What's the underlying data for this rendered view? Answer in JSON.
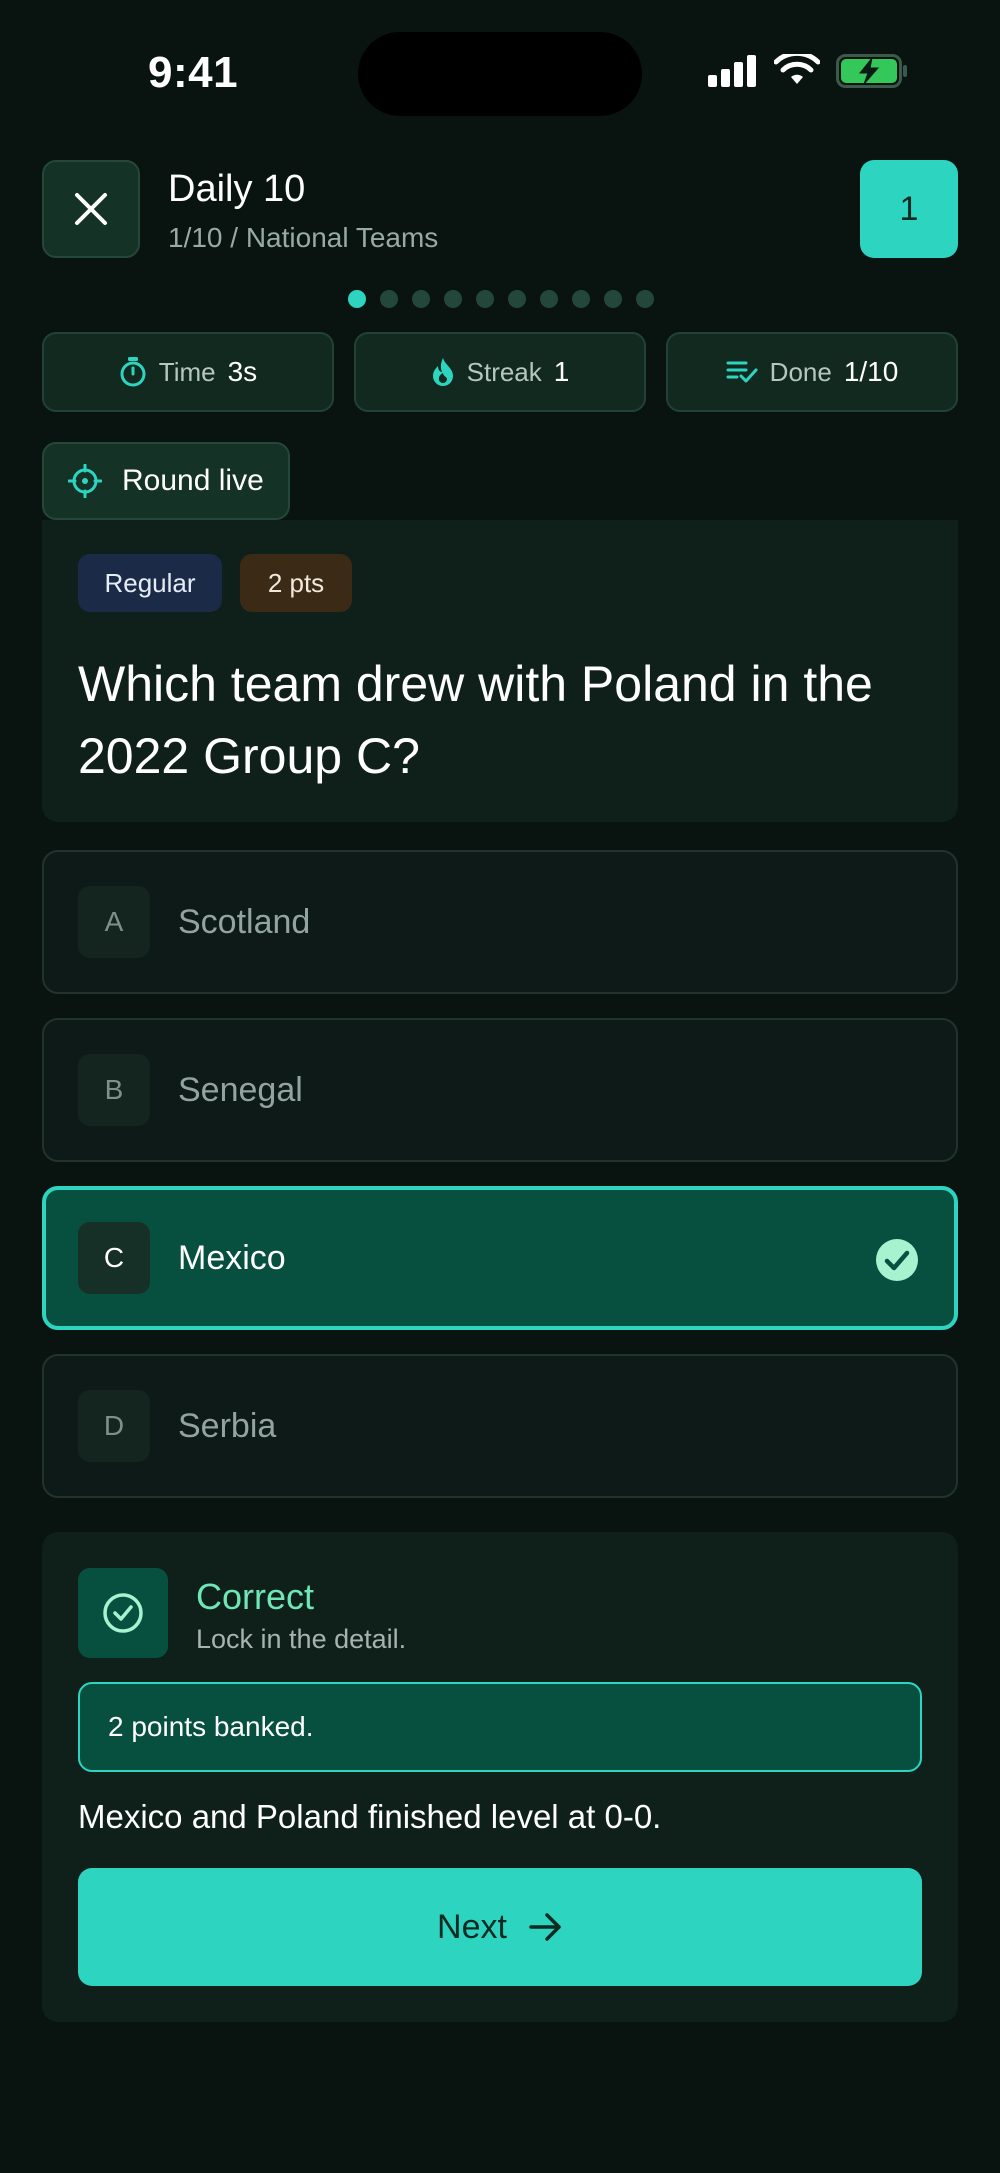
{
  "status_bar": {
    "time": "9:41"
  },
  "header": {
    "title": "Daily 10",
    "subtitle": "1/10 / National Teams",
    "score": "1",
    "progress": {
      "current": 1,
      "total": 10
    }
  },
  "stats": [
    {
      "icon": "timer-icon",
      "label": "Time",
      "value": "3s"
    },
    {
      "icon": "flame-icon",
      "label": "Streak",
      "value": "1"
    },
    {
      "icon": "checklist-icon",
      "label": "Done",
      "value": "1/10"
    }
  ],
  "round": {
    "label": "Round live"
  },
  "question": {
    "tags": {
      "difficulty": "Regular",
      "points": "2 pts"
    },
    "text": "Which team drew with Poland in the 2022 Group C?"
  },
  "answers": [
    {
      "letter": "A",
      "label": "Scotland",
      "selected": false
    },
    {
      "letter": "B",
      "label": "Senegal",
      "selected": false
    },
    {
      "letter": "C",
      "label": "Mexico",
      "selected": true
    },
    {
      "letter": "D",
      "label": "Serbia",
      "selected": false
    }
  ],
  "feedback": {
    "title": "Correct",
    "subtitle": "Lock in the detail.",
    "banked": "2 points banked.",
    "explanation": "Mexico and Poland finished level at 0-0.",
    "next_label": "Next"
  },
  "colors": {
    "background": "#091310",
    "accent": "#2dd4bf",
    "correct_text": "#6ee7b7",
    "selected_bg": "#07503f"
  }
}
